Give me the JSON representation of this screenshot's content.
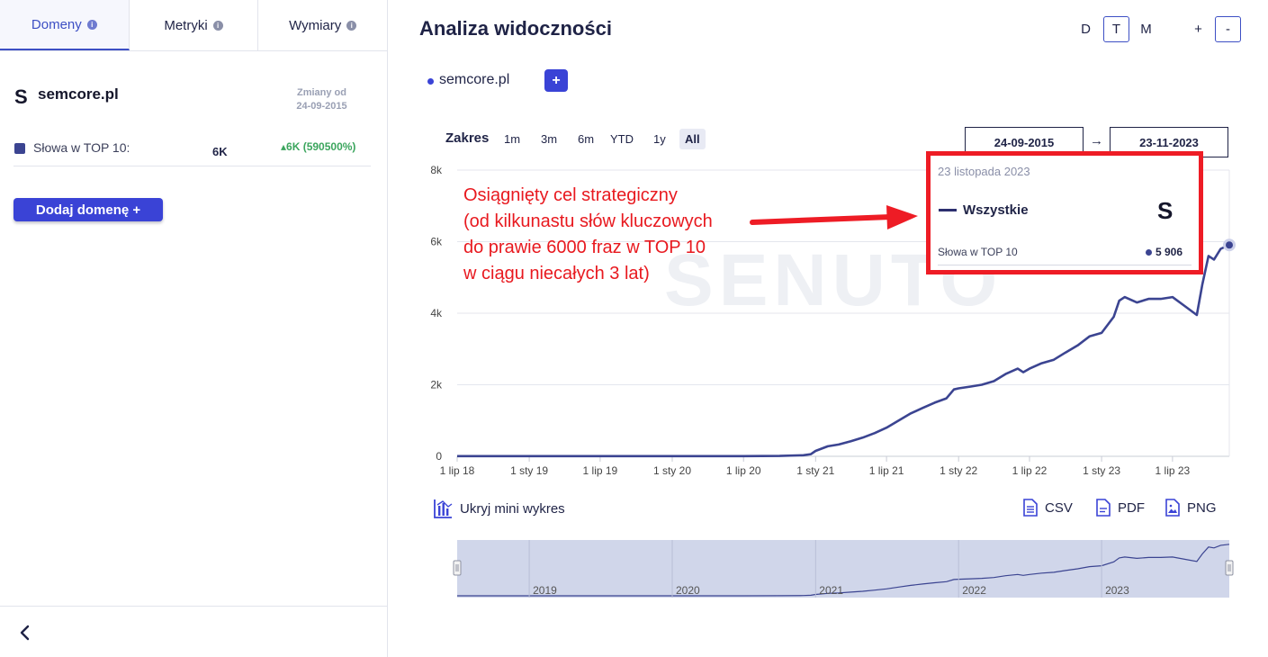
{
  "sidebar": {
    "tabs": [
      {
        "label": "Domeny",
        "active": true
      },
      {
        "label": "Metryki",
        "active": false
      },
      {
        "label": "Wymiary",
        "active": false
      }
    ],
    "info_glyph": "i",
    "domain": {
      "logo_letter": "S",
      "name": "semcore.pl"
    },
    "changes_label": "Zmiany od",
    "changes_date": "24-09-2015",
    "metric": {
      "label": "Słowa w TOP 10:",
      "value": "6K",
      "change": "▴6K (590500%)",
      "color": "#3b4491"
    },
    "add_domain_label": "Dodaj domenę +",
    "back_icon": "chevron-left-icon"
  },
  "header": {
    "title": "Analiza widoczności",
    "granularity": [
      {
        "label": "D",
        "active": false
      },
      {
        "label": "T",
        "active": true
      },
      {
        "label": "M",
        "active": false
      }
    ],
    "zoom_in": "+",
    "zoom_out": "-"
  },
  "series_bar": {
    "series_name": "semcore.pl",
    "add_label": "+"
  },
  "range": {
    "label": "Zakres",
    "options": [
      {
        "label": "1m",
        "active": false
      },
      {
        "label": "3m",
        "active": false
      },
      {
        "label": "6m",
        "active": false
      },
      {
        "label": "YTD",
        "active": false
      },
      {
        "label": "1y",
        "active": false
      },
      {
        "label": "All",
        "active": true
      }
    ],
    "date_from": "24-09-2015",
    "date_to": "23-11-2023",
    "arrow": "→"
  },
  "watermark": "SENUTO",
  "annotation": {
    "lines": [
      "Osiągnięty cel strategiczny",
      "(od kilkunastu słów kluczowych",
      "do prawie 6000 fraz w TOP 10",
      "w ciągu niecałych 3 lat)"
    ],
    "color": "#e8191f"
  },
  "tooltip": {
    "date": "23 listopada 2023",
    "series": "Wszystkie",
    "logo_letter": "S",
    "metric_label": "Słowa w TOP 10",
    "metric_value": "5 906",
    "border_color": "#ee1c25"
  },
  "chart_data": {
    "type": "line",
    "y_ticks": [
      "0",
      "2k",
      "4k",
      "6k",
      "8k"
    ],
    "ylim": [
      0,
      8000
    ],
    "x_ticks": [
      "1 lip 18",
      "1 sty 19",
      "1 lip 19",
      "1 sty 20",
      "1 lip 20",
      "1 sty 21",
      "1 lip 21",
      "1 sty 22",
      "1 lip 22",
      "1 sty 23",
      "1 lip 23"
    ],
    "xlim": [
      "2018-07-01",
      "2023-11-23"
    ],
    "grid": true,
    "line_color": "#3b4491",
    "series": [
      {
        "x": [
          "2018-07-01",
          "2019-07-01",
          "2020-07-01",
          "2020-10-01",
          "2020-12-01",
          "2020-12-20",
          "2021-01-01",
          "2021-02-01",
          "2021-03-01",
          "2021-04-01",
          "2021-05-01",
          "2021-06-01",
          "2021-07-01",
          "2021-08-01",
          "2021-09-01",
          "2021-10-01",
          "2021-11-01",
          "2021-12-01",
          "2021-12-20",
          "2022-01-01",
          "2022-02-01",
          "2022-03-01",
          "2022-04-01",
          "2022-05-01",
          "2022-06-01",
          "2022-06-15",
          "2022-07-01",
          "2022-08-01",
          "2022-09-01",
          "2022-10-01",
          "2022-11-01",
          "2022-12-01",
          "2023-01-01",
          "2023-02-01",
          "2023-02-15",
          "2023-03-01",
          "2023-04-01",
          "2023-05-01",
          "2023-06-01",
          "2023-07-01",
          "2023-08-01",
          "2023-09-01",
          "2023-09-15",
          "2023-10-01",
          "2023-10-15",
          "2023-11-01",
          "2023-11-23"
        ],
        "y": [
          5,
          5,
          5,
          10,
          30,
          60,
          150,
          280,
          330,
          420,
          520,
          650,
          800,
          1000,
          1200,
          1350,
          1500,
          1620,
          1870,
          1900,
          1950,
          2000,
          2100,
          2300,
          2450,
          2350,
          2450,
          2600,
          2700,
          2900,
          3100,
          3350,
          3450,
          3900,
          4350,
          4450,
          4300,
          4400,
          4400,
          4450,
          4200,
          3950,
          4800,
          5600,
          5500,
          5800,
          5906
        ]
      }
    ],
    "navigator": {
      "year_labels": [
        "2019",
        "2020",
        "2021",
        "2022",
        "2023"
      ],
      "fill_color": "#d0d6ea"
    }
  },
  "mini_chart": {
    "toggle_label": "Ukryj mini wykres",
    "icon": "bar-chart-icon"
  },
  "exports": [
    {
      "label": "CSV",
      "icon": "csv-file-icon"
    },
    {
      "label": "PDF",
      "icon": "pdf-file-icon"
    },
    {
      "label": "PNG",
      "icon": "image-file-icon"
    }
  ]
}
